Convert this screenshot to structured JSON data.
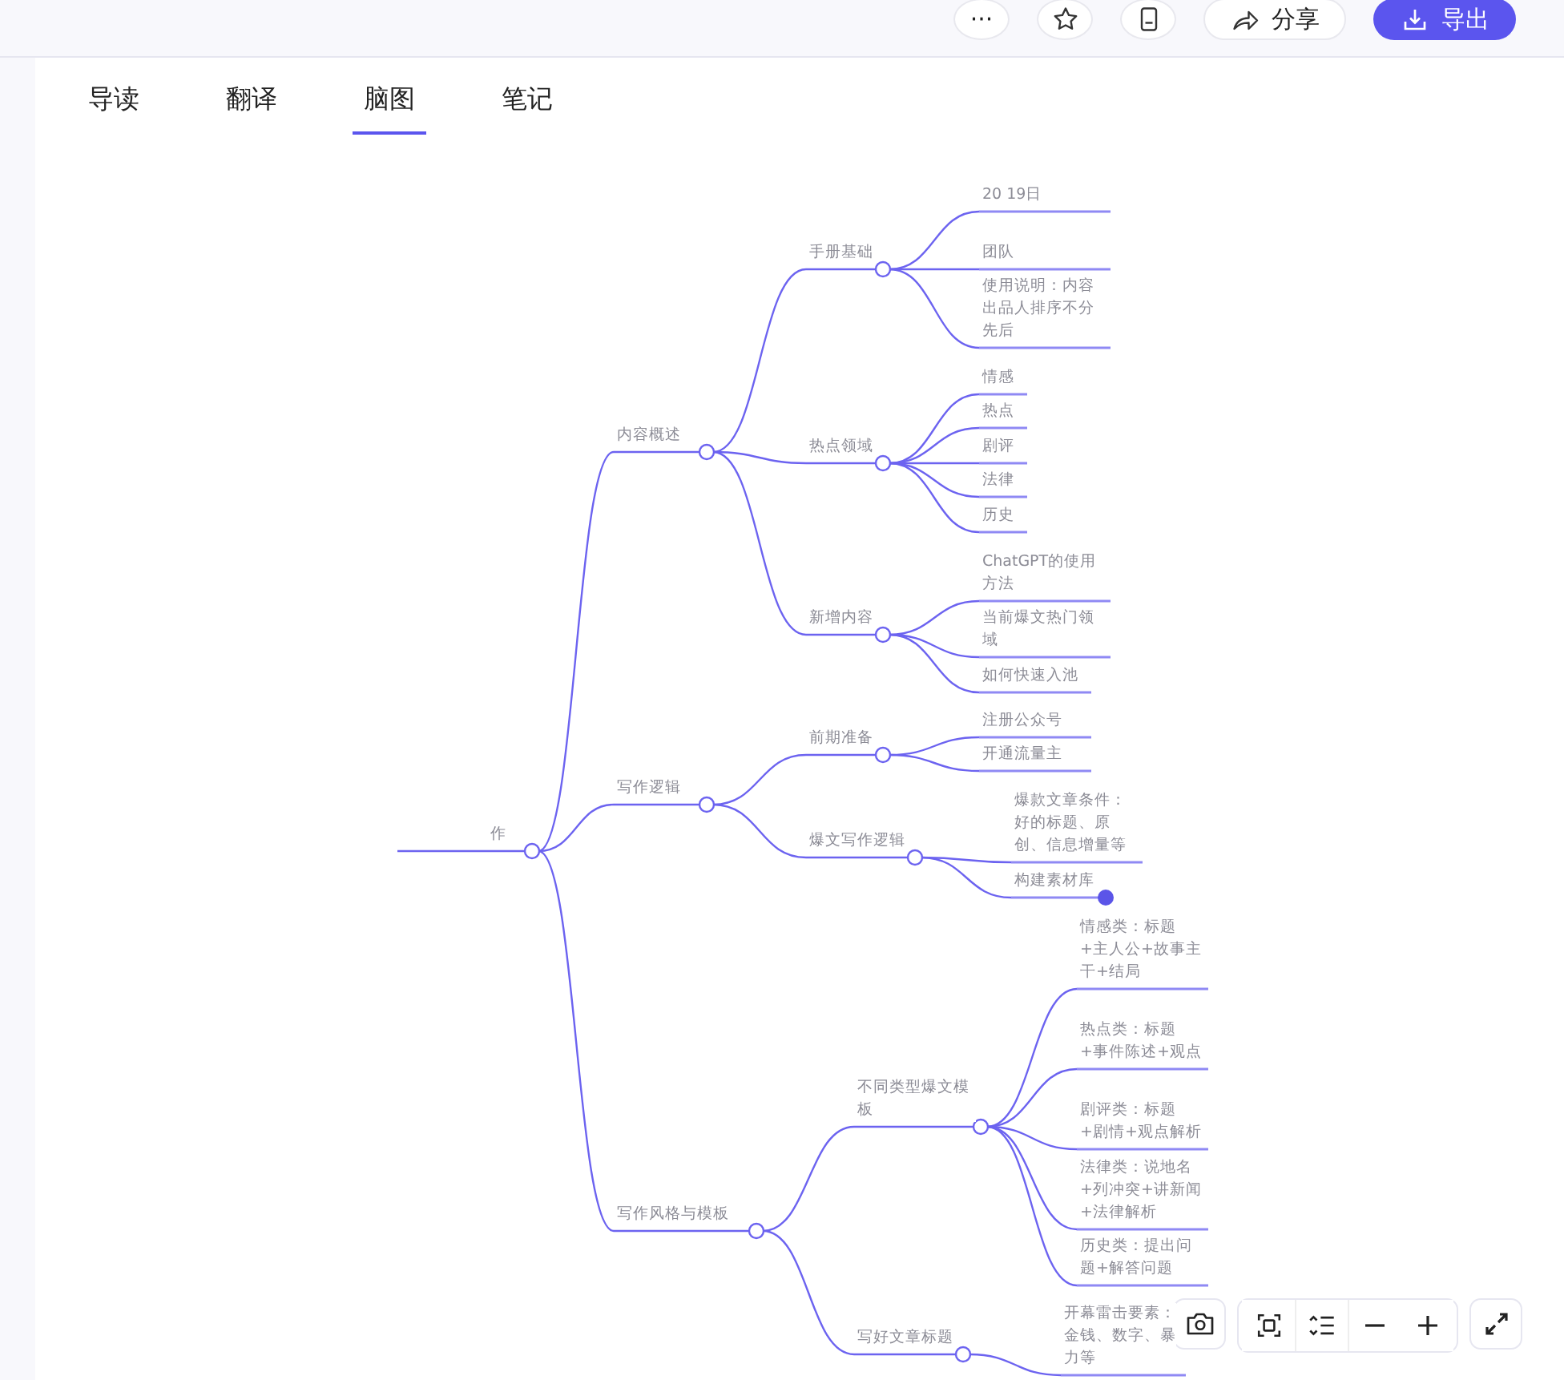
{
  "toolbar": {
    "buttons": [
      {
        "kind": "more",
        "label": "···"
      },
      {
        "kind": "star"
      },
      {
        "kind": "clipboard"
      },
      {
        "kind": "share",
        "label": "分享"
      },
      {
        "kind": "export",
        "label": "导出"
      }
    ]
  },
  "tabs": [
    {
      "label": "导读",
      "selected": false
    },
    {
      "label": "翻译",
      "selected": false
    },
    {
      "label": "脑图",
      "selected": true
    },
    {
      "label": "笔记",
      "selected": false
    }
  ],
  "mindmap": {
    "label": "作",
    "children": [
      {
        "label": "内容概述",
        "children": [
          {
            "label": "手册基础",
            "children": [
              {
                "label": "20 19日"
              },
              {
                "label": "团队"
              },
              {
                "label": "使用说明：内容出品人排序不分先后"
              }
            ]
          },
          {
            "label": "热点领域",
            "children": [
              {
                "label": "情感"
              },
              {
                "label": "热点"
              },
              {
                "label": "剧评"
              },
              {
                "label": "法律"
              },
              {
                "label": "历史"
              }
            ]
          },
          {
            "label": "新增内容",
            "children": [
              {
                "label": "ChatGPT的使用方法"
              },
              {
                "label": "当前爆文热门领域"
              },
              {
                "label": "如何快速入池"
              }
            ]
          }
        ]
      },
      {
        "label": "写作逻辑",
        "children": [
          {
            "label": "前期准备",
            "children": [
              {
                "label": "注册公众号"
              },
              {
                "label": "开通流量主"
              }
            ]
          },
          {
            "label": "爆文写作逻辑",
            "children": [
              {
                "label": "爆款文章条件：好的标题、原创、信息增量等",
                "collapsed": false
              },
              {
                "label": "构建素材库",
                "collapsed": true
              }
            ]
          }
        ]
      },
      {
        "label": "写作风格与模板",
        "children": [
          {
            "label": "不同类型爆文模板",
            "children": [
              {
                "label": "情感类：标题+主人公+故事主干+结局"
              },
              {
                "label": "热点类：标题+事件陈述+观点"
              },
              {
                "label": "剧评类：标题+剧情+观点解析"
              },
              {
                "label": "法律类：说地名+列冲突+讲新闻+法律解析"
              },
              {
                "label": "历史类：提出问题+解答问题"
              }
            ]
          },
          {
            "label": "写好文章标题",
            "children": [
              {
                "label": "开幕雷击要素：金钱、数字、暴力等"
              }
            ]
          }
        ]
      }
    ]
  },
  "map_tools": [
    {
      "kind": "camera"
    },
    {
      "kind": "fit"
    },
    {
      "kind": "outline"
    },
    {
      "kind": "zoom-out"
    },
    {
      "kind": "zoom-in"
    },
    {
      "kind": "fullscreen"
    }
  ]
}
